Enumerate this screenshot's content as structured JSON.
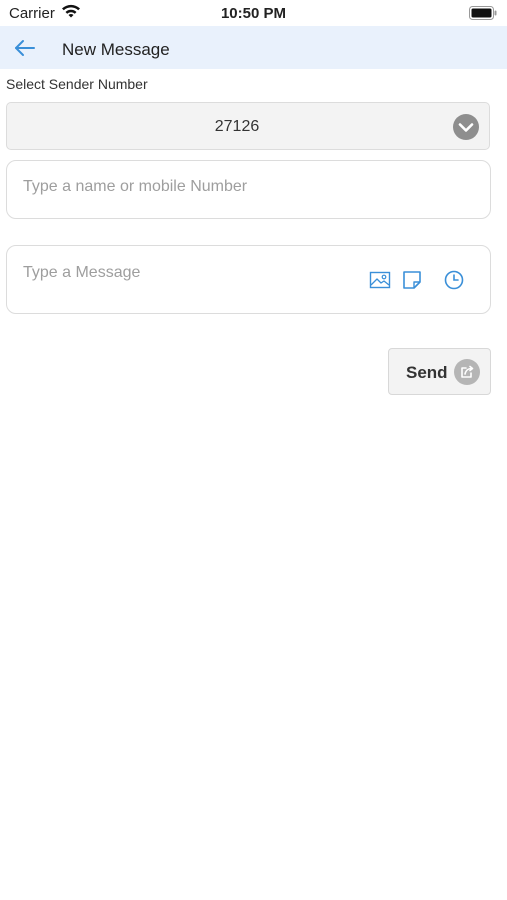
{
  "status_bar": {
    "carrier": "Carrier",
    "time": "10:50 PM"
  },
  "nav": {
    "title": "New Message",
    "back_icon": "arrow-left-icon"
  },
  "sender": {
    "label": "Select Sender Number",
    "selected_value": "27126"
  },
  "recipient": {
    "placeholder": "Type a name or mobile Number"
  },
  "message": {
    "placeholder": "Type a Message",
    "icons": [
      "image-icon",
      "note-icon",
      "clock-icon"
    ]
  },
  "send": {
    "label": "Send",
    "icon": "send-icon"
  },
  "colors": {
    "accent": "#3a8fd8",
    "nav_background": "#e9f1fc",
    "placeholder": "#9e9e9e",
    "chevron_badge": "#8e8e8e"
  }
}
